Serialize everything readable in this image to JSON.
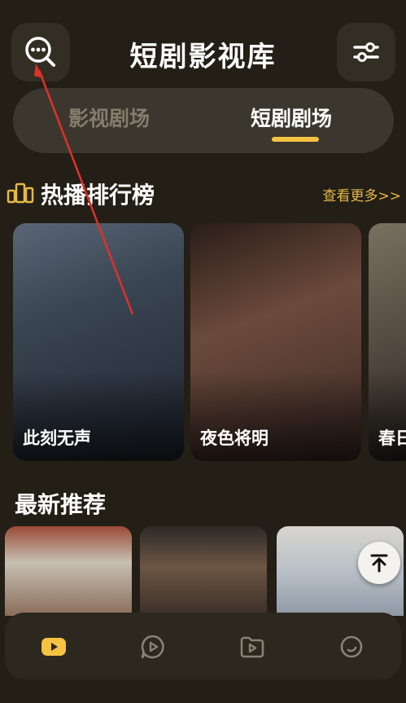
{
  "header": {
    "title": "短剧影视库",
    "search_icon": "search-icon",
    "filter_icon": "sliders-icon"
  },
  "tabs": [
    {
      "label": "影视剧场",
      "active": false
    },
    {
      "label": "短剧剧场",
      "active": true
    }
  ],
  "hot_section": {
    "title": "热播排行榜",
    "more_label": "查看更多>>",
    "icon": "ranking-icon",
    "items": [
      {
        "title": "此刻无声"
      },
      {
        "title": "夜色将明"
      },
      {
        "title": "春日"
      }
    ]
  },
  "new_section": {
    "title": "最新推荐",
    "item_count_visible": 3
  },
  "fab": {
    "icon": "back-to-top-icon"
  },
  "bottom_nav": {
    "items": [
      {
        "icon": "home-play-icon",
        "active": true
      },
      {
        "icon": "chat-play-icon",
        "active": false
      },
      {
        "icon": "folder-play-icon",
        "active": false
      },
      {
        "icon": "circle-icon",
        "active": false
      }
    ]
  },
  "colors": {
    "background": "#231f16",
    "accent": "#f5c242",
    "more_link": "#e5b848",
    "annotation_arrow": "#e0302a"
  }
}
